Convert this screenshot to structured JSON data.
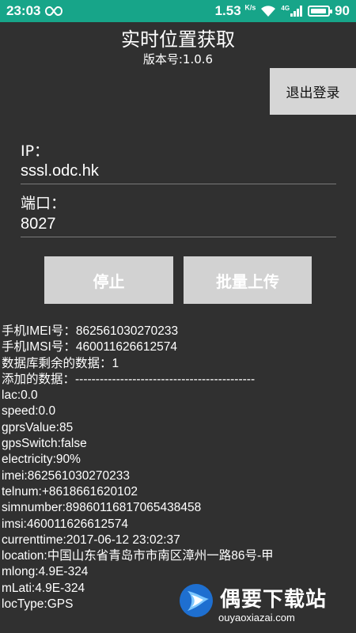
{
  "status_bar": {
    "time": "23:03",
    "link_icon": "infinity-icon",
    "speed": "1.53",
    "speed_unit": "K/s",
    "network": "4G",
    "battery_level": "90"
  },
  "header": {
    "title": "实时位置获取",
    "version": "版本号:1.0.6",
    "logout_label": "退出登录"
  },
  "form": {
    "ip_label": "IP：",
    "ip_value": "sssl.odc.hk",
    "port_label": "端口：",
    "port_value": "8027"
  },
  "actions": {
    "stop_label": "停止",
    "batch_upload_label": "批量上传"
  },
  "info_lines": [
    "手机IMEI号：862561030270233",
    "手机IMSI号：460011626612574",
    "数据库剩余的数据：1",
    "添加的数据：--------------------------------------------",
    "lac:0.0",
    "speed:0.0",
    "gprsValue:85",
    "gpsSwitch:false",
    "electricity:90%",
    "imei:862561030270233",
    "telnum:+8618661620102",
    "simnumber:89860116817065438458",
    "imsi:460011626612574",
    "currenttime:2017-06-12 23:02:37",
    "location:中国山东省青岛市市南区漳州一路86号-甲",
    "mlong:4.9E-324",
    "mLati:4.9E-324",
    " locType:GPS"
  ],
  "watermark": {
    "text": "偶要下载站",
    "url": "ouyaoxiazai.com"
  },
  "colors": {
    "status_bar": "#17a589",
    "background": "#303030",
    "button": "#d2d2d2"
  }
}
